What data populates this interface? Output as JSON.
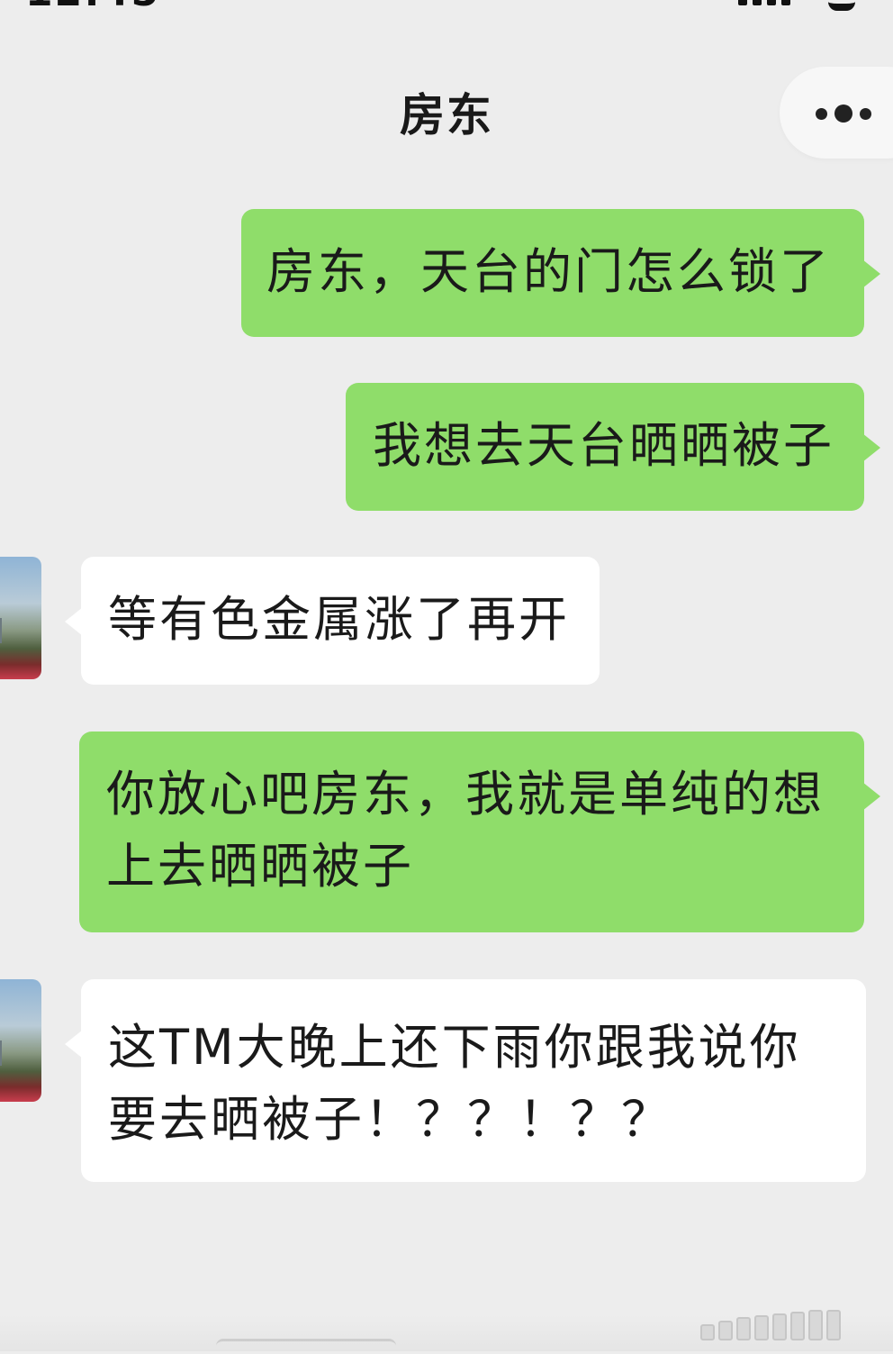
{
  "chat": {
    "title": "房东"
  },
  "messages": [
    {
      "side": "outgoing",
      "text": "房东，天台的门怎么锁了"
    },
    {
      "side": "outgoing",
      "text": "我想去天台晒晒被子"
    },
    {
      "side": "incoming",
      "text": "等有色金属涨了再开"
    },
    {
      "side": "outgoing",
      "text": "你放心吧房东，我就是单纯的想上去晒晒被子"
    },
    {
      "side": "incoming",
      "text": " 这TM大晚上还下雨你跟我说你要去晒被子！？？！？？"
    }
  ],
  "colors": {
    "background": "#ededed",
    "outgoing_bubble": "#8fdd6a",
    "incoming_bubble": "#ffffff"
  },
  "icons": {
    "more": "more-dots-icon"
  }
}
